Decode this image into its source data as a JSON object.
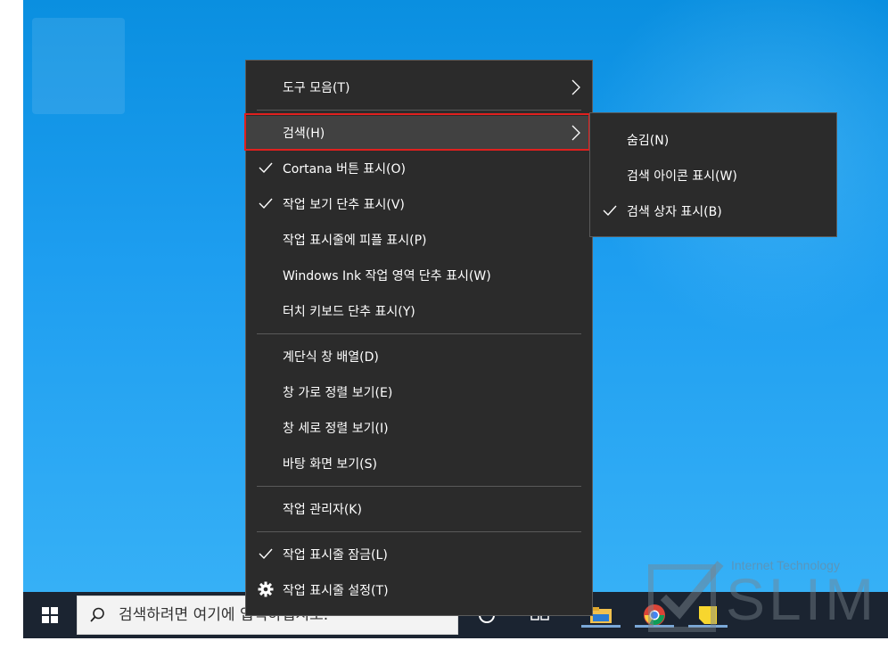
{
  "taskbar": {
    "search_placeholder": "검색하려면 여기에 입력하십시오."
  },
  "context_menu": {
    "items": [
      {
        "label": "도구 모음(T)",
        "checked": false,
        "submenu": true
      },
      {
        "label": "검색(H)",
        "checked": false,
        "submenu": true,
        "highlighted": true
      },
      {
        "label": "Cortana 버튼 표시(O)",
        "checked": true
      },
      {
        "label": "작업 보기 단추 표시(V)",
        "checked": true
      },
      {
        "label": "작업 표시줄에 피플 표시(P)",
        "checked": false
      },
      {
        "label": "Windows Ink 작업 영역 단추 표시(W)",
        "checked": false
      },
      {
        "label": "터치 키보드 단추 표시(Y)",
        "checked": false
      },
      {
        "label": "계단식 창 배열(D)",
        "checked": false
      },
      {
        "label": "창 가로 정렬 보기(E)",
        "checked": false
      },
      {
        "label": "창 세로 정렬 보기(I)",
        "checked": false
      },
      {
        "label": "바탕 화면 보기(S)",
        "checked": false
      },
      {
        "label": "작업 관리자(K)",
        "checked": false
      },
      {
        "label": "작업 표시줄 잠금(L)",
        "checked": true
      },
      {
        "label": "작업 표시줄 설정(T)",
        "icon": "gear-icon"
      }
    ]
  },
  "search_submenu": {
    "items": [
      {
        "label": "숨김(N)",
        "checked": false
      },
      {
        "label": "검색 아이콘 표시(W)",
        "checked": false
      },
      {
        "label": "검색 상자 표시(B)",
        "checked": true
      }
    ]
  },
  "watermark": {
    "subtitle": "Internet Technology",
    "title": "SLIM"
  },
  "colors": {
    "menu_bg": "#2b2b2b",
    "menu_hover": "#414141",
    "highlight_border": "#e0201e",
    "taskbar_bg": "#1b2431",
    "desktop": "#1e9ef0"
  }
}
